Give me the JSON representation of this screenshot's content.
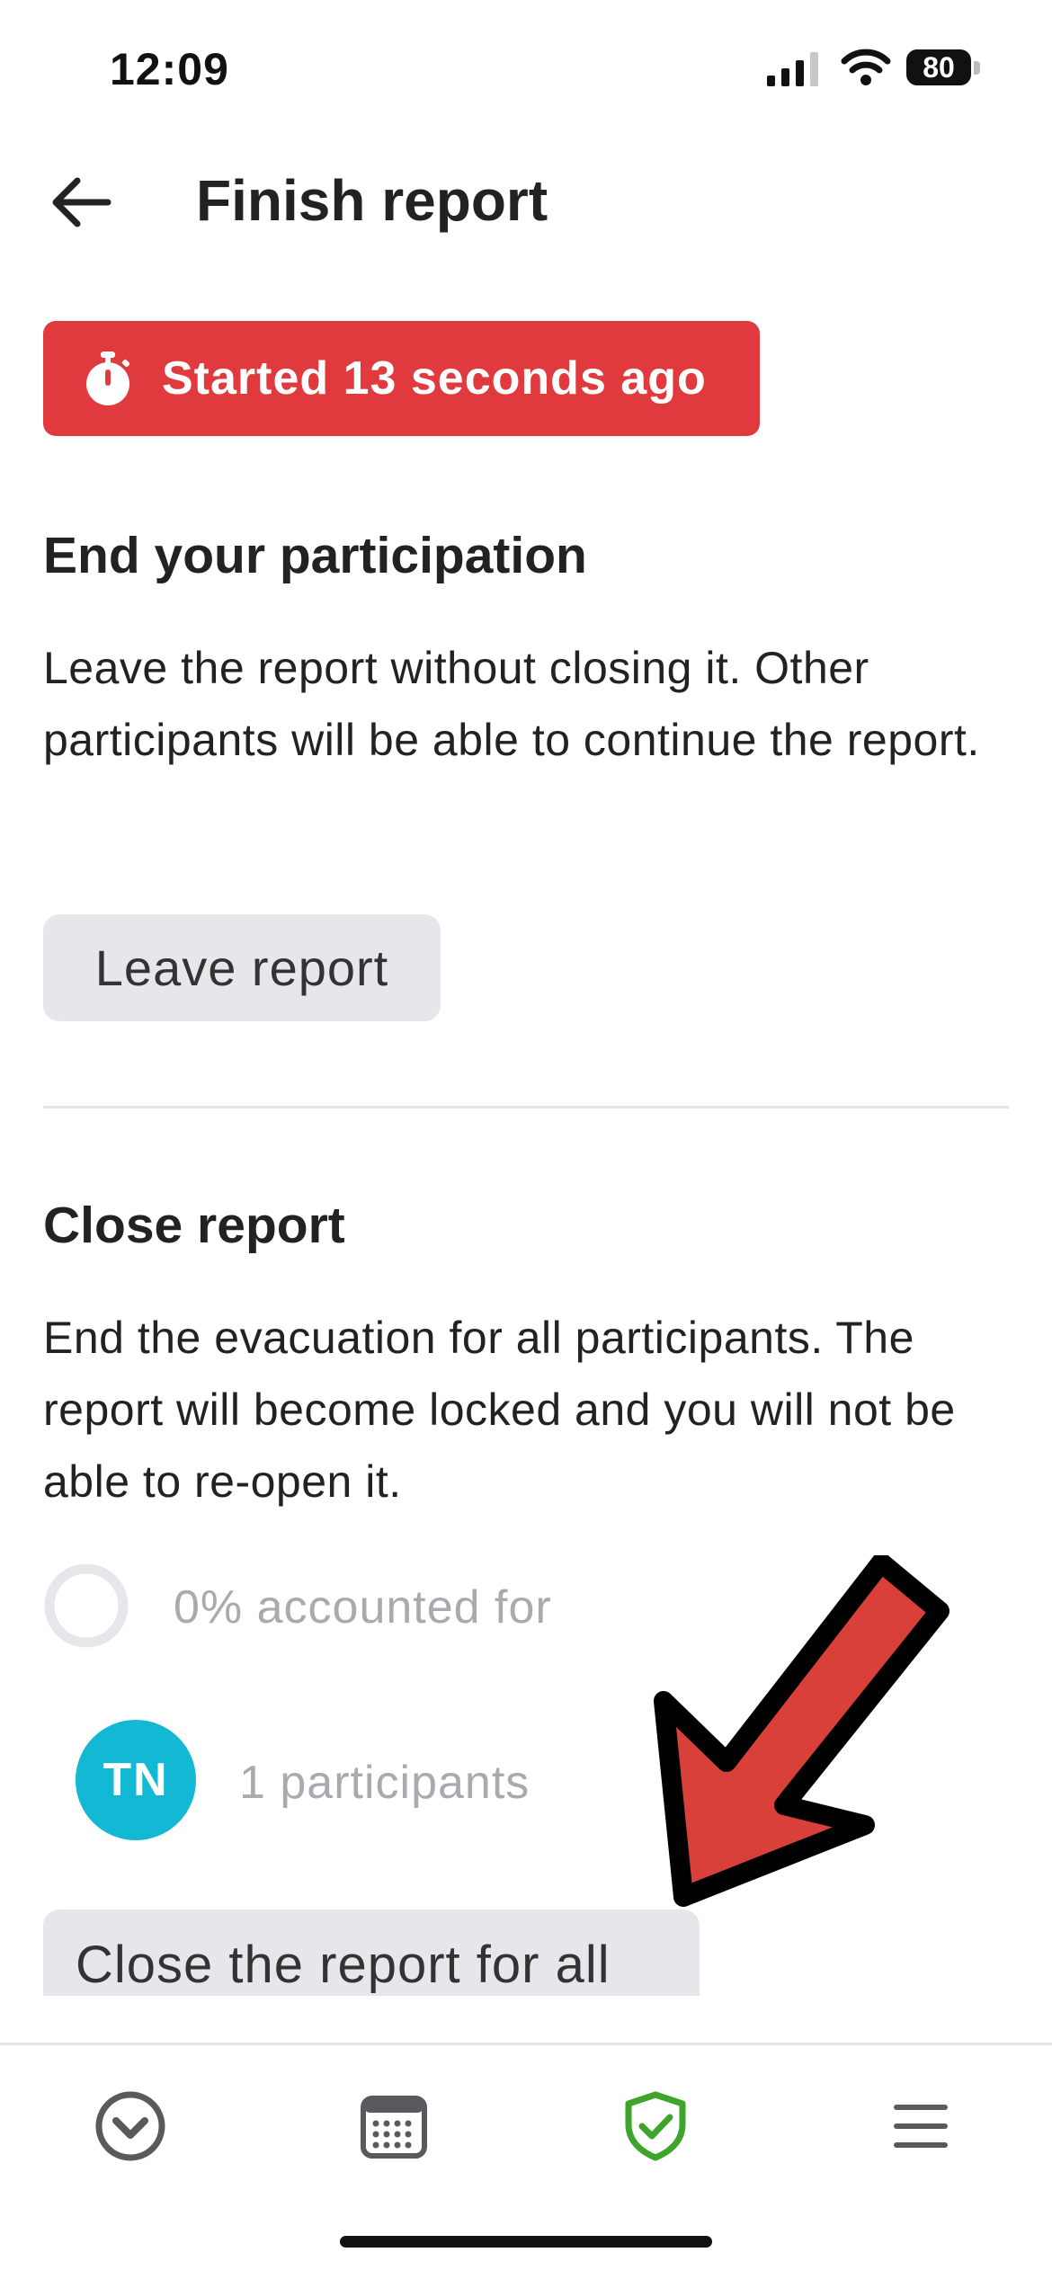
{
  "status_bar": {
    "time": "12:09",
    "battery_level": "80",
    "icons": [
      "signal-icon",
      "wifi-icon",
      "battery-icon"
    ]
  },
  "header": {
    "title": "Finish report",
    "back_icon": "arrow-left-icon"
  },
  "timer_badge": {
    "text": "Started 13 seconds ago",
    "icon": "stopwatch-icon",
    "color": "#e0393e"
  },
  "end_participation": {
    "title": "End your participation",
    "description": "Leave the report without closing it. Other participants will be able to continue the report.",
    "button_label": "Leave report"
  },
  "close_report": {
    "title": "Close report",
    "description": "End the evacuation for all participants. The report will become locked and you will not be able to re-open it.",
    "progress_text": "0% accounted for",
    "progress_percent": 0,
    "avatar_initials": "TN",
    "avatar_color": "#12b8d4",
    "participants_text": "1 participants",
    "button_label": "Close the report for all"
  },
  "annotation": {
    "icon": "red-arrow-annotation",
    "color": "#d9403a"
  },
  "tab_bar": {
    "items": [
      {
        "icon": "chevron-down-circle-icon"
      },
      {
        "icon": "calendar-icon"
      },
      {
        "icon": "shield-check-icon",
        "active": true,
        "active_color": "#3ea52a"
      },
      {
        "icon": "menu-icon"
      }
    ]
  }
}
